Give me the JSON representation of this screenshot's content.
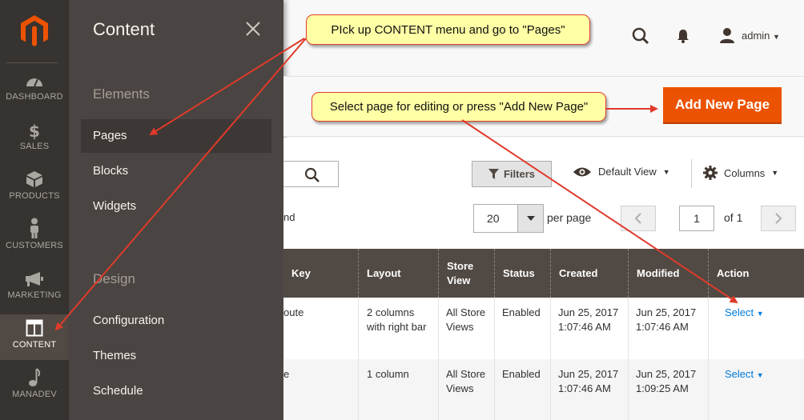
{
  "nav": {
    "items": [
      {
        "label": "DASHBOARD",
        "icon": "dashboard-icon"
      },
      {
        "label": "SALES",
        "icon": "dollar-icon"
      },
      {
        "label": "PRODUCTS",
        "icon": "box-icon"
      },
      {
        "label": "CUSTOMERS",
        "icon": "person-icon"
      },
      {
        "label": "MARKETING",
        "icon": "megaphone-icon"
      },
      {
        "label": "CONTENT",
        "icon": "content-icon"
      },
      {
        "label": "MANADEV",
        "icon": "note-icon"
      }
    ]
  },
  "flyout": {
    "title": "Content",
    "sections": [
      {
        "heading": "Elements",
        "items": [
          "Pages",
          "Blocks",
          "Widgets"
        ]
      },
      {
        "heading": "Design",
        "items": [
          "Configuration",
          "Themes",
          "Schedule"
        ]
      }
    ]
  },
  "header": {
    "user": "admin"
  },
  "toolbar": {
    "add_label": "Add New Page"
  },
  "grid": {
    "filters_label": "Filters",
    "view_label": "Default View",
    "columns_label": "Columns",
    "found_fragment": "nd",
    "per_page_value": "20",
    "per_page_label": "per page",
    "page_value": "1",
    "page_of": "of 1",
    "headers": [
      "Key",
      "Layout",
      "Store View",
      "Status",
      "Created",
      "Modified",
      "Action"
    ],
    "rows": [
      {
        "key": "oute",
        "layout": "2 columns with right bar",
        "store": "All Store Views",
        "status": "Enabled",
        "created": "Jun 25, 2017 1:07:46 AM",
        "modified": "Jun 25, 2017 1:07:46 AM",
        "action": "Select"
      },
      {
        "key": "e",
        "layout": "1 column",
        "store": "All Store Views",
        "status": "Enabled",
        "created": "Jun 25, 2017 1:07:46 AM",
        "modified": "Jun 25, 2017 1:09:25 AM",
        "action": "Select"
      }
    ]
  },
  "callouts": {
    "top": "PIck up CONTENT menu and go to  \"Pages\"",
    "middle": "Select page for editing or press \"Add New Page\""
  },
  "colors": {
    "accent": "#eb5202",
    "callout_bg": "#ffffa5",
    "arrow": "#e03a2a",
    "link": "#007bdb"
  }
}
